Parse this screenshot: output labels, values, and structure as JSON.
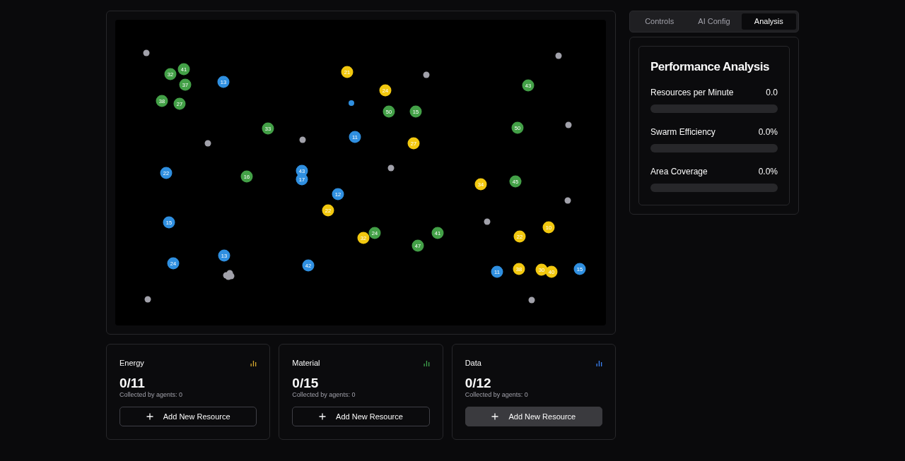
{
  "canvas": {
    "nodes": [
      {
        "kind": "agent"
      },
      {
        "kind": "agent"
      },
      {
        "kind": "agent"
      },
      {
        "kind": "agent"
      },
      {
        "kind": "agent"
      },
      {
        "kind": "agent"
      },
      {
        "kind": "agent"
      },
      {
        "kind": "agent"
      },
      {
        "kind": "agent"
      },
      {
        "kind": "agent-cluster"
      },
      {
        "kind": "agent"
      },
      {
        "kind": "agent"
      },
      {
        "kind": "data"
      },
      {
        "kind": "material",
        "label": "32"
      },
      {
        "kind": "material",
        "label": "41"
      },
      {
        "kind": "material",
        "label": "37"
      },
      {
        "kind": "material",
        "label": "38"
      },
      {
        "kind": "material",
        "label": "27"
      },
      {
        "kind": "material",
        "label": "33"
      },
      {
        "kind": "material",
        "label": "50"
      },
      {
        "kind": "material",
        "label": "15"
      },
      {
        "kind": "material",
        "label": "43"
      },
      {
        "kind": "material",
        "label": "50"
      },
      {
        "kind": "material",
        "label": "16"
      },
      {
        "kind": "material",
        "label": "45"
      },
      {
        "kind": "material",
        "label": "24"
      },
      {
        "kind": "material",
        "label": "41"
      },
      {
        "kind": "material",
        "label": "47"
      },
      {
        "kind": "data",
        "label": "13"
      },
      {
        "kind": "data",
        "label": "11"
      },
      {
        "kind": "data",
        "label": "22"
      },
      {
        "kind": "data",
        "label": "43"
      },
      {
        "kind": "data",
        "label": "17"
      },
      {
        "kind": "data",
        "label": "12"
      },
      {
        "kind": "data",
        "label": "15"
      },
      {
        "kind": "data",
        "label": "13"
      },
      {
        "kind": "data",
        "label": "24"
      },
      {
        "kind": "data",
        "label": "42"
      },
      {
        "kind": "data",
        "label": "11"
      },
      {
        "kind": "data",
        "label": "15"
      },
      {
        "kind": "energy",
        "label": "21"
      },
      {
        "kind": "energy",
        "label": "24"
      },
      {
        "kind": "energy",
        "label": "27"
      },
      {
        "kind": "energy",
        "label": "34"
      },
      {
        "kind": "energy",
        "label": "22"
      },
      {
        "kind": "energy",
        "label": "32"
      },
      {
        "kind": "energy",
        "label": "22"
      },
      {
        "kind": "energy",
        "label": "10"
      },
      {
        "kind": "energy",
        "label": "38"
      },
      {
        "kind": "energy",
        "label": "30"
      },
      {
        "kind": "energy",
        "label": "40"
      }
    ]
  },
  "resources": [
    {
      "name": "Energy",
      "color": "#d4a72c",
      "count": "0/11",
      "collected": "Collected by agents: 0",
      "button": "Add New Resource",
      "button_hovered": false
    },
    {
      "name": "Material",
      "color": "#3fa34d",
      "count": "0/15",
      "collected": "Collected by agents: 0",
      "button": "Add New Resource",
      "button_hovered": false
    },
    {
      "name": "Data",
      "color": "#3b82f6",
      "count": "0/12",
      "collected": "Collected by agents: 0",
      "button": "Add New Resource",
      "button_hovered": true
    }
  ],
  "tabs": [
    {
      "label": "Controls",
      "selected": false
    },
    {
      "label": "AI Config",
      "selected": false
    },
    {
      "label": "Analysis",
      "selected": true
    }
  ],
  "analysis": {
    "title": "Performance Analysis",
    "metrics": [
      {
        "label": "Resources per Minute",
        "reading": "0.0",
        "level": 0
      },
      {
        "label": "Swarm Efficiency",
        "reading": "0.0%",
        "level": 0
      },
      {
        "label": "Area Coverage",
        "reading": "0.0%",
        "level": 0
      }
    ]
  }
}
